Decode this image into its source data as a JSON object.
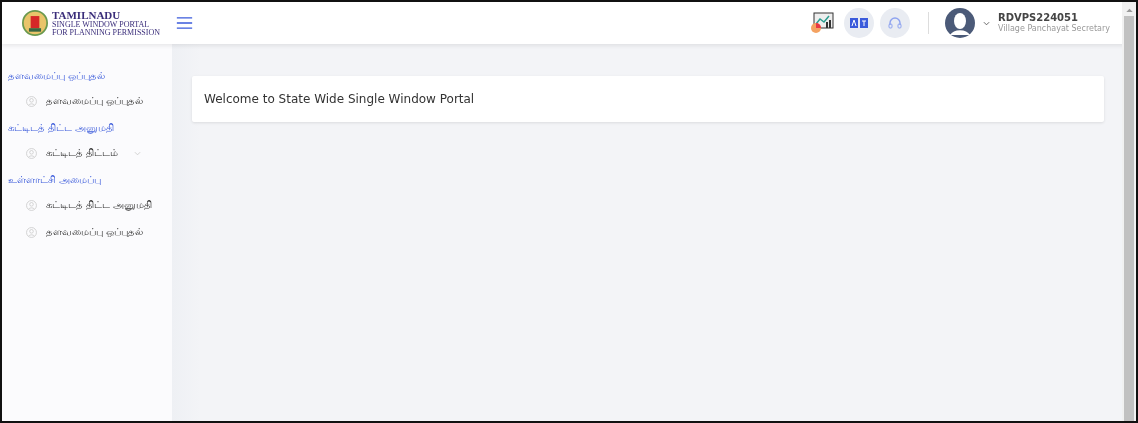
{
  "logo": {
    "title": "TAMILNADU",
    "line_1": "SINGLE WINDOW PORTAL",
    "line_2": "FOR PLANNING PERMISSION"
  },
  "user": {
    "id": "RDVPS224051",
    "role": "Village Panchayat Secretary"
  },
  "sidebar": [
    {
      "heading": "தளவமைப்பு ஒப்புதல்",
      "items": [
        {
          "label": "தளவமைப்பு ஒப்புதல்",
          "expandable": false
        }
      ]
    },
    {
      "heading": "கட்டிடத் திட்ட அனுமதி",
      "items": [
        {
          "label": "கட்டிடத் திட்டம்",
          "expandable": true
        }
      ]
    },
    {
      "heading": "உள்ளாட்சி அமைப்பு",
      "items": [
        {
          "label": "கட்டிடத் திட்ட அனுமதி",
          "expandable": false
        },
        {
          "label": "தளவமைப்பு ஒப்புதல்",
          "expandable": false
        }
      ]
    }
  ],
  "welcome": "Welcome to State Wide Single Window Portal"
}
